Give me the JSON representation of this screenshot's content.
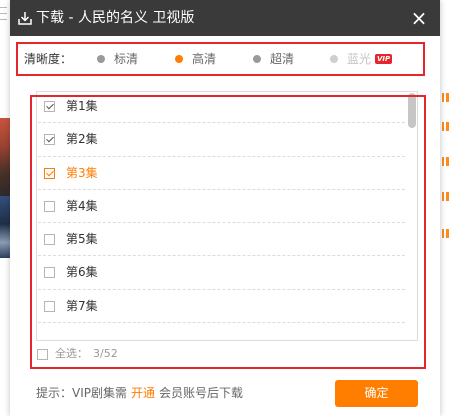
{
  "dialog": {
    "title": "下载 - 人民的名义 卫视版",
    "close_glyph": "×"
  },
  "quality": {
    "label": "清晰度：",
    "options": [
      {
        "label": "标清",
        "selected": false,
        "disabled": false
      },
      {
        "label": "高清",
        "selected": true,
        "disabled": false
      },
      {
        "label": "超清",
        "selected": false,
        "disabled": false
      },
      {
        "label": "蓝光",
        "selected": false,
        "disabled": true,
        "badge": "VIP"
      }
    ]
  },
  "episodes": [
    {
      "label": "第1集",
      "checked": true,
      "active": false
    },
    {
      "label": "第2集",
      "checked": true,
      "active": false
    },
    {
      "label": "第3集",
      "checked": true,
      "active": true
    },
    {
      "label": "第4集",
      "checked": false,
      "active": false
    },
    {
      "label": "第5集",
      "checked": false,
      "active": false
    },
    {
      "label": "第6集",
      "checked": false,
      "active": false
    },
    {
      "label": "第7集",
      "checked": false,
      "active": false
    }
  ],
  "select_all": {
    "label": "全选：",
    "count": "3/52",
    "checked": false
  },
  "footer": {
    "hint_prefix": "提示：VIP剧集需",
    "hint_link": "开通",
    "hint_suffix": "会员账号后下载",
    "confirm_label": "确定"
  },
  "icons": {
    "title": "download-icon",
    "close": "close-icon",
    "checkbox": "check-icon",
    "radio": "radio-dot-icon"
  },
  "colors": {
    "accent": "#ff7e00",
    "header_bg": "#3a3a3a",
    "annotation": "#e5262d",
    "vip_badge": "#e5262d",
    "muted_text": "#999999"
  }
}
